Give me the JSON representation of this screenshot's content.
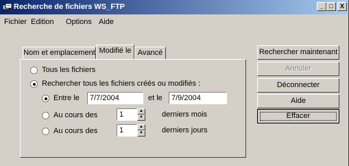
{
  "window": {
    "title": "Recherche de fichiers WS_FTP"
  },
  "titlebar_buttons": {
    "minimize": "_",
    "maximize": "□",
    "close": "X"
  },
  "menu": {
    "items": [
      "Fichier",
      "Edition",
      "Options",
      "Aide"
    ]
  },
  "tabs": [
    {
      "label": "Nom et emplacement",
      "active": false
    },
    {
      "label": "Modifié le",
      "active": true
    },
    {
      "label": "Avancé",
      "active": false
    }
  ],
  "panel": {
    "all_files": {
      "label": "Tous les fichiers",
      "selected": false
    },
    "search_modified": {
      "label": "Rechercher tous les fichiers créés ou modifiés :",
      "selected": true
    },
    "between": {
      "label": "Entre le",
      "selected": true,
      "from": "7/7/2004",
      "and_label": "et le",
      "to": "7/9/2004"
    },
    "last_months": {
      "label": "Au cours des",
      "selected": false,
      "value": "1",
      "unit": "derniers mois"
    },
    "last_days": {
      "label": "Au cours des",
      "selected": false,
      "value": "1",
      "unit": "derniers jours"
    }
  },
  "buttons": {
    "search": "Rechercher maintenant",
    "cancel": "Annuler",
    "disconnect": "Déconnecter",
    "help": "Aide",
    "clear": "Effacer"
  }
}
